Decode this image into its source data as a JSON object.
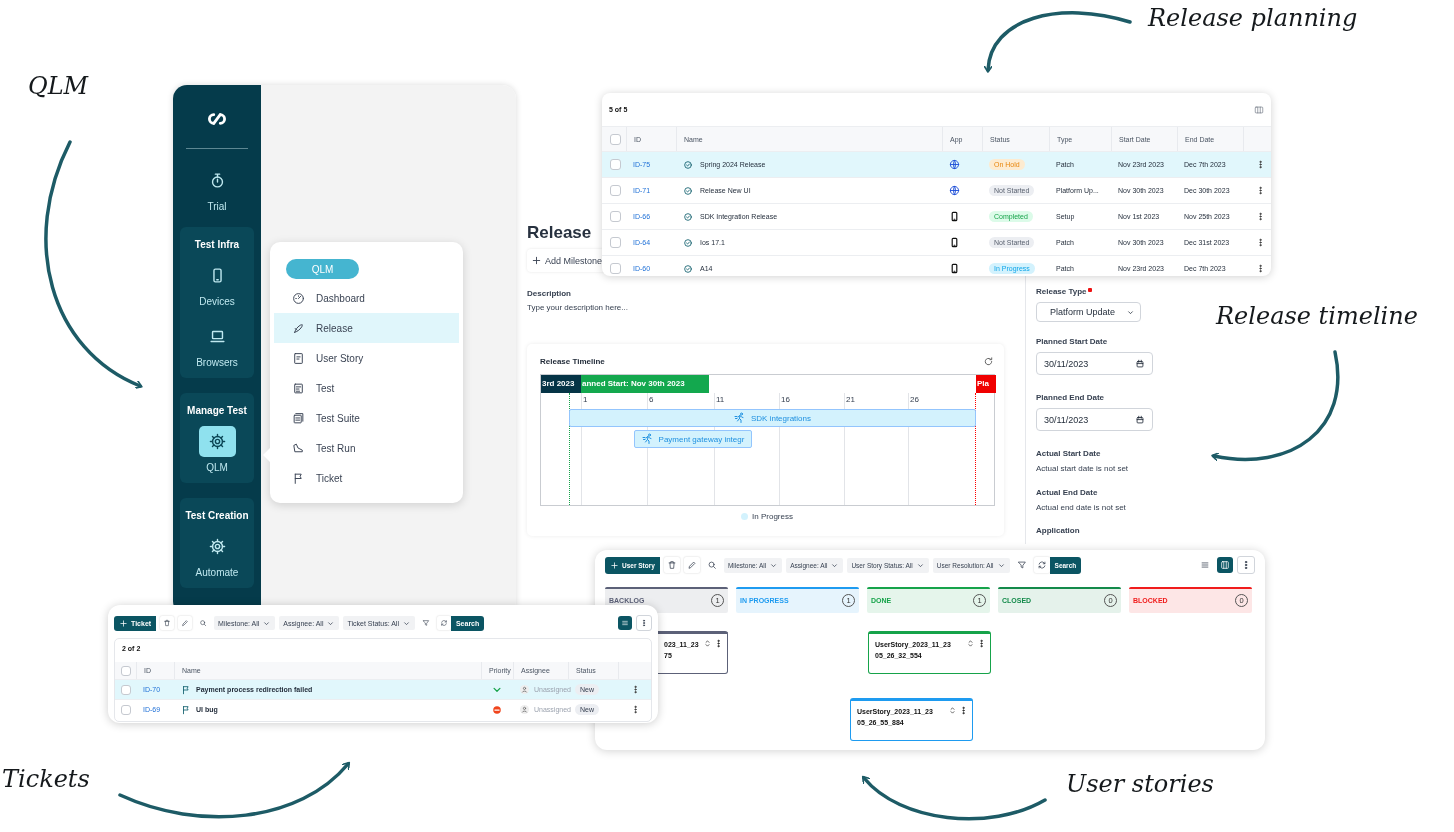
{
  "annotations": [
    {
      "text": "QLM"
    },
    {
      "text": "Release planning"
    },
    {
      "text": "Release timeline"
    },
    {
      "text": "Tickets"
    },
    {
      "text": "User stories"
    }
  ],
  "sidebar": {
    "items": [
      {
        "label": "Trial",
        "selected": false
      }
    ],
    "groups": [
      {
        "title": "Test Infra",
        "items": [
          {
            "label": "Devices",
            "selected": false
          },
          {
            "label": "Browsers",
            "selected": false
          }
        ]
      },
      {
        "title": "Manage Test",
        "items": [
          {
            "label": "QLM",
            "selected": true
          }
        ]
      },
      {
        "title": "Test Creation",
        "items": [
          {
            "label": "Automate",
            "selected": false
          }
        ]
      }
    ]
  },
  "qlm_menu": {
    "title": "QLM",
    "items": [
      {
        "label": "Dashboard",
        "selected": false
      },
      {
        "label": "Release",
        "selected": true
      },
      {
        "label": "User Story",
        "selected": false
      },
      {
        "label": "Test",
        "selected": false
      },
      {
        "label": "Test Suite",
        "selected": false
      },
      {
        "label": "Test Run",
        "selected": false
      },
      {
        "label": "Ticket",
        "selected": false
      }
    ]
  },
  "release_page": {
    "title": "Release",
    "add_milestone": "Add Milestone",
    "description_label": "Description",
    "description": "Type your description here...",
    "timeline": {
      "title": "Release Timeline",
      "markers": [
        {
          "label": "3rd 2023",
          "kind": "past"
        },
        {
          "label": "anned Start: Nov 30th 2023",
          "kind": "start"
        },
        {
          "label": "Pla",
          "kind": "end"
        }
      ],
      "day_ticks": [
        "1",
        "6",
        "11",
        "16",
        "21",
        "26"
      ],
      "bars": [
        {
          "label": "SDK integrations"
        },
        {
          "label": "Payment gateway integr"
        }
      ],
      "legend": [
        {
          "label": "In Progress",
          "color": "#d3f2fd"
        }
      ]
    }
  },
  "details": {
    "release_type": {
      "label": "Release Type",
      "required": true,
      "value": "Platform Update"
    },
    "planned_start": {
      "label": "Planned Start Date",
      "value": "30/11/2023"
    },
    "planned_end": {
      "label": "Planned End Date",
      "value": "30/11/2023"
    },
    "actual_start": {
      "label": "Actual Start Date",
      "text": "Actual start date is not set"
    },
    "actual_end": {
      "label": "Actual End Date",
      "text": "Actual end date is not set"
    },
    "application_label": "Application"
  },
  "release_table": {
    "count": "5 of 5",
    "all_checked": false,
    "columns": [
      "ID",
      "Name",
      "App",
      "Status",
      "Type",
      "Start Date",
      "End Date"
    ],
    "rows": [
      {
        "id": "ID-75",
        "name": "Spring 2024 Release",
        "app": {
          "kind": "web"
        },
        "status": {
          "text": "On Hold",
          "kind": "hold"
        },
        "type": "Patch",
        "start": "Nov 23rd 2023",
        "end": "Dec 7th 2023",
        "selected": true,
        "checked": false
      },
      {
        "id": "ID-71",
        "name": "Release New UI",
        "app": {
          "kind": "web"
        },
        "status": {
          "text": "Not Started",
          "kind": "not_started"
        },
        "type": "Platform Up...",
        "start": "Nov 30th 2023",
        "end": "Dec 30th 2023",
        "selected": false,
        "checked": false
      },
      {
        "id": "ID-66",
        "name": "SDK Integration Release",
        "app": {
          "kind": "mobile"
        },
        "status": {
          "text": "Completed",
          "kind": "completed"
        },
        "type": "Setup",
        "start": "Nov 1st 2023",
        "end": "Nov 25th 2023",
        "selected": false,
        "checked": false
      },
      {
        "id": "ID-64",
        "name": "Ios 17.1",
        "app": {
          "kind": "mobile"
        },
        "status": {
          "text": "Not Started",
          "kind": "not_started"
        },
        "type": "Patch",
        "start": "Nov 30th 2023",
        "end": "Dec 31st 2023",
        "selected": false,
        "checked": false
      },
      {
        "id": "ID-60",
        "name": "A14",
        "app": {
          "kind": "mobile"
        },
        "status": {
          "text": "In Progress",
          "kind": "in_progress"
        },
        "type": "Patch",
        "start": "Nov 23rd 2023",
        "end": "Dec 7th 2023",
        "selected": false,
        "checked": false
      }
    ]
  },
  "tickets": {
    "new_button": "Ticket",
    "filters": [
      "Milestone: All",
      "Assignee: All",
      "Ticket Status: All"
    ],
    "search_button": "Search",
    "count": "2 of 2",
    "all_checked": false,
    "columns": [
      "ID",
      "Name",
      "Priority",
      "Assignee",
      "Status"
    ],
    "rows": [
      {
        "id": "ID-70",
        "name": "Payment process redirection failed",
        "priority": {
          "kind": "low"
        },
        "assignee": "Unassigned",
        "status": "New",
        "selected": true,
        "checked": false
      },
      {
        "id": "ID-69",
        "name": "UI bug",
        "priority": {
          "kind": "blocker"
        },
        "assignee": "Unassigned",
        "status": "New",
        "selected": false,
        "checked": false
      }
    ]
  },
  "user_stories": {
    "new_button": "User Story",
    "filters": [
      "Milestone: All",
      "Assignee: All",
      "User Story Status: All",
      "User Resolution: All"
    ],
    "search_button": "Search",
    "views": [
      {
        "kind": "list",
        "selected": false
      },
      {
        "kind": "board",
        "selected": true
      }
    ],
    "columns": [
      {
        "title": "BACKLOG",
        "count": "1",
        "color": "#5c6178"
      },
      {
        "title": "IN PROGRESS",
        "count": "1",
        "color": "#1e9bf0"
      },
      {
        "title": "DONE",
        "count": "1",
        "color": "#16a34a"
      },
      {
        "title": "CLOSED",
        "count": "0",
        "color": "#138a4a"
      },
      {
        "title": "BLOCKED",
        "count": "0",
        "color": "#f01c1c"
      }
    ],
    "cards": [
      {
        "lines": [
          "023_11_23",
          "75"
        ],
        "color": "#5c6178"
      },
      {
        "lines": [
          "UserStory_2023_11_23",
          "05_26_32_554"
        ],
        "color": "#16a34a"
      },
      {
        "lines": [
          "UserStory_2023_11_23",
          "05_26_55_884"
        ],
        "color": "#1e9bf0"
      }
    ]
  }
}
